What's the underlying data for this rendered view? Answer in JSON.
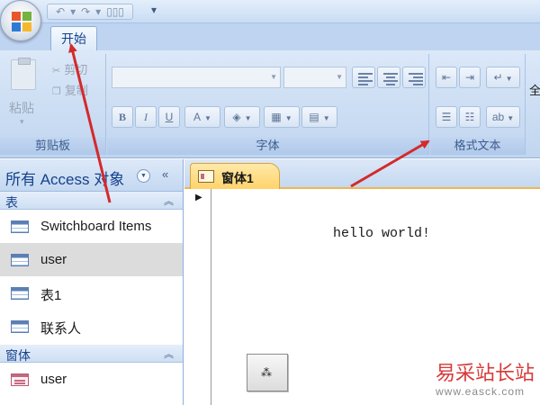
{
  "window": {
    "tab_home": "开始"
  },
  "ribbon": {
    "clipboard": {
      "paste_label": "粘贴",
      "cut_label": "剪切",
      "copy_label": "复制",
      "group_label": "剪贴板"
    },
    "font": {
      "group_label": "字体",
      "bold": "B",
      "italic": "I",
      "underline": "U",
      "font_color": "A"
    },
    "formatted_text": {
      "group_label": "格式文本"
    },
    "overflow_label": "全"
  },
  "nav_pane": {
    "title": "所有 Access 对象",
    "sections": [
      {
        "label": "表",
        "items": [
          {
            "label": "Switchboard Items",
            "selected": false
          },
          {
            "label": "user",
            "selected": true
          },
          {
            "label": "表1",
            "selected": false
          },
          {
            "label": "联系人",
            "selected": false
          }
        ]
      },
      {
        "label": "窗体",
        "items": [
          {
            "label": "user",
            "selected": false
          }
        ]
      }
    ]
  },
  "document": {
    "tab_label": "窗体1",
    "label_text": "hello world!",
    "command_button_glyph": "⁂"
  },
  "watermark": {
    "site_name": "易采站长站",
    "url": "www.easck.com"
  },
  "colors": {
    "accent_arrow": "#d42a2a",
    "ribbon_bg": "#c8dbf2",
    "tab_active": "#ffd36a"
  }
}
